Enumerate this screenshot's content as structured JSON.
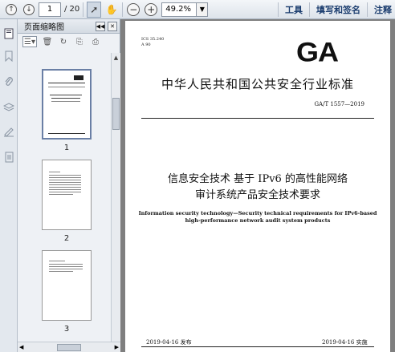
{
  "toolbar": {
    "page_current": "1",
    "page_total": "/ 20",
    "zoom": "49.2%",
    "menu_tools": "工具",
    "menu_sign": "填写和签名",
    "menu_comment": "注释"
  },
  "sidebar": {
    "title": "页面缩略图",
    "thumbnails": [
      {
        "label": "1"
      },
      {
        "label": "2"
      },
      {
        "label": "3"
      }
    ]
  },
  "document": {
    "ics": "ICS 35.240",
    "ccs": "A 90",
    "logo": "GA",
    "standard_title": "中华人民共和国公共安全行业标准",
    "standard_code": "GA/T 1557—2019",
    "title_cn_line1": "信息安全技术  基于 IPv6 的高性能网络",
    "title_cn_line2": "审计系统产品安全技术要求",
    "title_en_line1": "Information security technology—Security technical requirements for IPv6-based",
    "title_en_line2": "high-performance network audit system products",
    "publish_date": "2019-04-16 发布",
    "implement_date": "2019-04-16 实施"
  }
}
